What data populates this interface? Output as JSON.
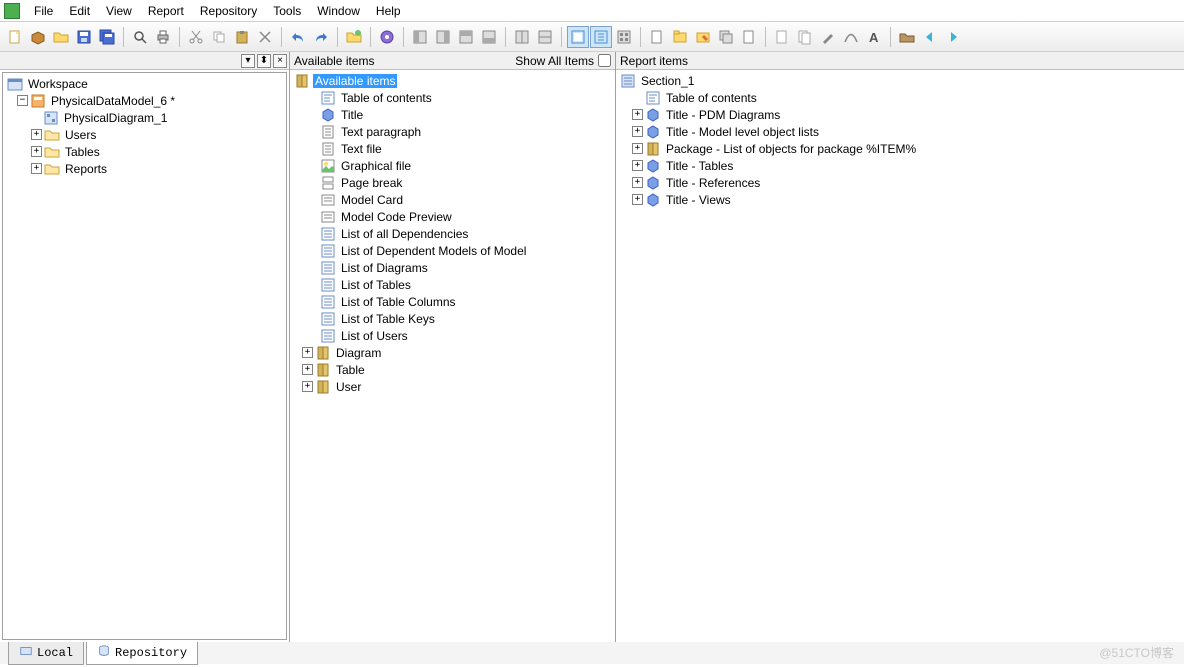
{
  "menu": [
    "File",
    "Edit",
    "View",
    "Report",
    "Repository",
    "Tools",
    "Window",
    "Help"
  ],
  "toolbar_groups": [
    [
      "new",
      "open",
      "openfolder",
      "save",
      "saveall"
    ],
    [
      "find",
      "print"
    ],
    [
      "cut",
      "copy",
      "paste",
      "delete"
    ],
    [
      "undo",
      "redo"
    ],
    [
      "newreport"
    ],
    [
      "properties"
    ],
    [
      "layout1",
      "layout2",
      "layout3",
      "layout4"
    ],
    [
      "layout5",
      "layout6"
    ],
    [
      "layout7",
      "layout8",
      "layout9"
    ],
    [
      "newfolder",
      "pkg-yellow",
      "pkg-edit",
      "pkg-copy",
      "page"
    ],
    [
      "doc",
      "docs",
      "pen",
      "curve",
      "text-a"
    ],
    [
      "stamp",
      "arrow-left",
      "arrow-right"
    ]
  ],
  "toolbar_active": [
    "layout7",
    "layout8"
  ],
  "workspace": {
    "root": "Workspace",
    "model": "PhysicalDataModel_6 *",
    "diagram": "PhysicalDiagram_1",
    "folders": [
      "Users",
      "Tables",
      "Reports"
    ]
  },
  "available": {
    "title": "Available items",
    "show_all_label": "Show All Items",
    "root": "Available items",
    "items": [
      "Table of contents",
      "Title",
      "Text paragraph",
      "Text file",
      "Graphical file",
      "Page break",
      "Model Card",
      "Model Code Preview",
      "List of all Dependencies",
      "List of Dependent Models of Model",
      "List of Diagrams",
      "List of Tables",
      "List of Table Columns",
      "List of Table Keys",
      "List of Users"
    ],
    "sub": [
      "Diagram",
      "Table",
      "User"
    ]
  },
  "report": {
    "title": "Report items",
    "root": "Section_1",
    "items": [
      {
        "icon": "toc",
        "label": "Table of contents",
        "exp": false
      },
      {
        "icon": "title",
        "label": "Title - PDM Diagrams",
        "exp": true
      },
      {
        "icon": "title",
        "label": "Title - Model level object lists",
        "exp": true
      },
      {
        "icon": "pkg",
        "label": "Package - List of objects for package %ITEM%",
        "exp": true
      },
      {
        "icon": "title",
        "label": "Title - Tables",
        "exp": true
      },
      {
        "icon": "title",
        "label": "Title - References",
        "exp": true
      },
      {
        "icon": "title",
        "label": "Title - Views",
        "exp": true
      }
    ]
  },
  "bottom_tabs": {
    "local": "Local",
    "repository": "Repository"
  },
  "watermark": "@51CTO博客"
}
